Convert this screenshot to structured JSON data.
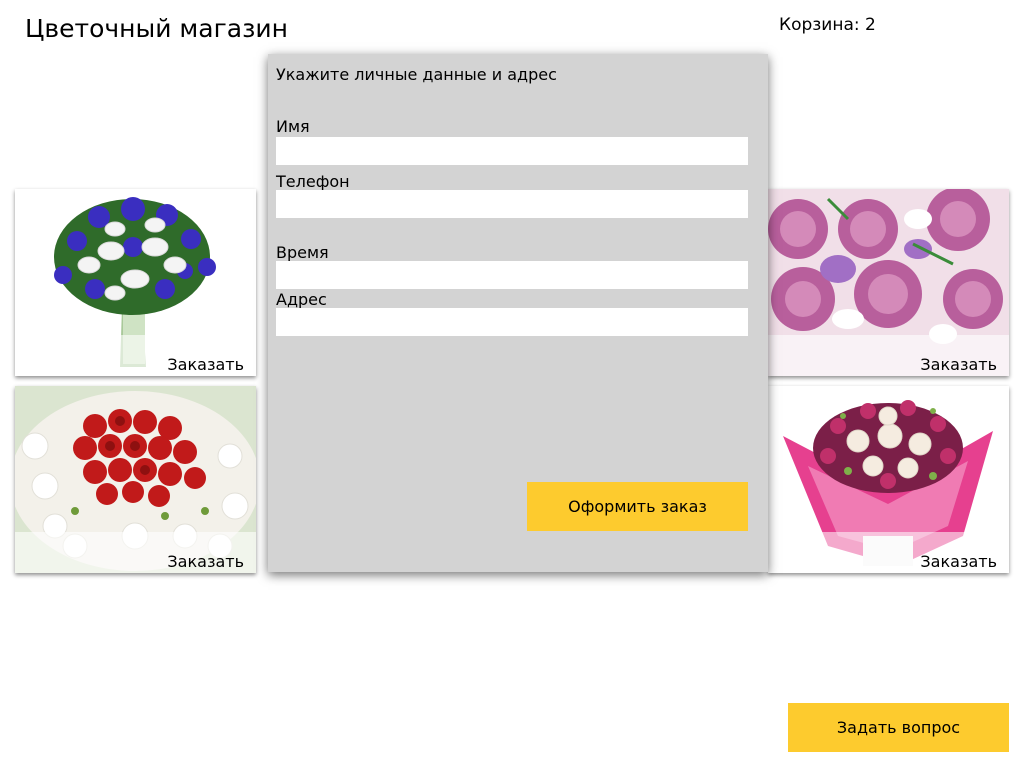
{
  "header": {
    "title": "Цветочный магазин",
    "cart_label": "Корзина: 2"
  },
  "products": [
    {
      "order_label": "Заказать",
      "icon": "iris-lily-bouquet-image"
    },
    {
      "order_label": "Заказать",
      "icon": "pink-rose-bouquet-image"
    },
    {
      "order_label": "Заказать",
      "icon": "red-rose-bouquet-image"
    },
    {
      "order_label": "Заказать",
      "icon": "chrysanthemum-bouquet-image"
    }
  ],
  "modal": {
    "title": "Укажите личные данные и адрес",
    "fields": [
      {
        "label": "Имя",
        "value": "",
        "placeholder": ""
      },
      {
        "label": "Телефон",
        "value": "",
        "placeholder": ""
      },
      {
        "label": "Время",
        "value": "",
        "placeholder": ""
      },
      {
        "label": "Адрес",
        "value": "",
        "placeholder": ""
      }
    ],
    "submit_label": "Оформить заказ"
  },
  "ask_question_label": "Задать вопрос",
  "colors": {
    "accent": "#fdcb2e",
    "modal_bg": "#d3d3d3",
    "input_bg": "#ffffff"
  }
}
